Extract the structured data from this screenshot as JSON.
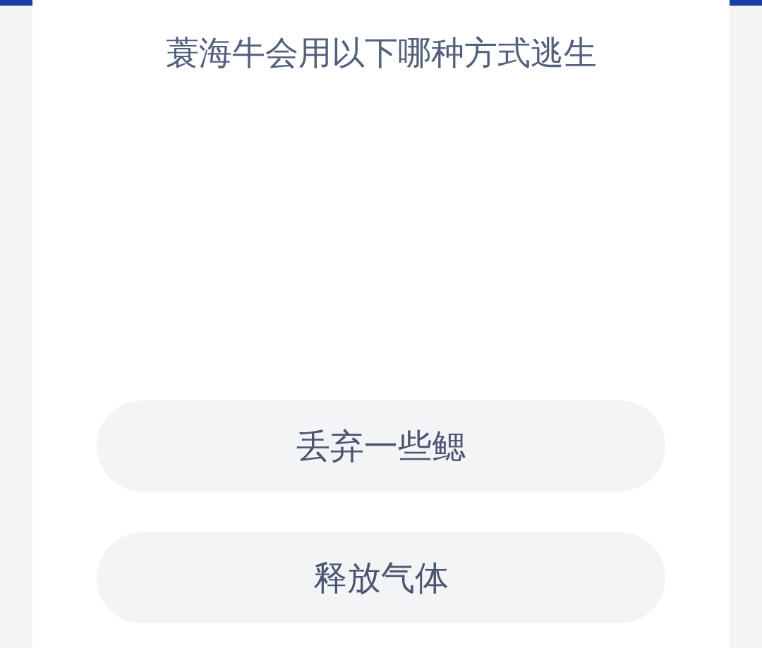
{
  "question": "蓑海牛会用以下哪种方式逃生",
  "options": [
    {
      "label": "丢弃一些鳃"
    },
    {
      "label": "释放气体"
    }
  ]
}
